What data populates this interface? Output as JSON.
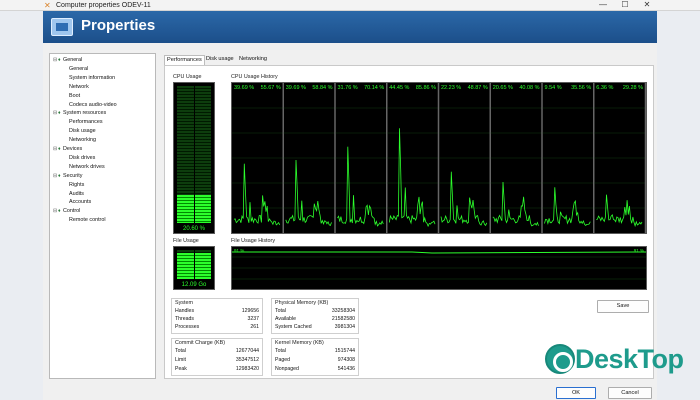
{
  "window": {
    "title": "Computer properties ODEV-11"
  },
  "header": {
    "title": "Properties"
  },
  "tree": [
    {
      "label": "General",
      "level": 0,
      "expanded": true
    },
    {
      "label": "General",
      "level": 1
    },
    {
      "label": "System information",
      "level": 1
    },
    {
      "label": "Network",
      "level": 1
    },
    {
      "label": "Boot",
      "level": 1
    },
    {
      "label": "Codecs audio-video",
      "level": 1
    },
    {
      "label": "System resources",
      "level": 0,
      "expanded": true
    },
    {
      "label": "Performances",
      "level": 1
    },
    {
      "label": "Disk usage",
      "level": 1
    },
    {
      "label": "Networking",
      "level": 1
    },
    {
      "label": "Devices",
      "level": 0,
      "expanded": true
    },
    {
      "label": "Disk drives",
      "level": 1
    },
    {
      "label": "Network drives",
      "level": 1
    },
    {
      "label": "Security",
      "level": 0,
      "expanded": true
    },
    {
      "label": "Rights",
      "level": 1
    },
    {
      "label": "Audits",
      "level": 1
    },
    {
      "label": "Accounts",
      "level": 1
    },
    {
      "label": "Control",
      "level": 0,
      "expanded": true
    },
    {
      "label": "Remote control",
      "level": 1
    }
  ],
  "tabs": [
    "Performances",
    "Disk usage",
    "Networking"
  ],
  "cpu": {
    "usage_label": "CPU Usage",
    "usage_value": "20.60 %",
    "usage_fraction": 0.206,
    "history_label": "CPU Usage History",
    "cores": [
      {
        "a": "39.69 %",
        "b": "55.67 %"
      },
      {
        "a": "39.69 %",
        "b": "58.84 %"
      },
      {
        "a": "31.76 %",
        "b": "70.14 %"
      },
      {
        "a": "44.45 %",
        "b": "85.86 %"
      },
      {
        "a": "22.23 %",
        "b": "48.87 %"
      },
      {
        "a": "20.65 %",
        "b": "40.08 %"
      },
      {
        "a": "9.54 %",
        "b": "35.56 %"
      },
      {
        "a": "6.36 %",
        "b": "29.28 %"
      }
    ]
  },
  "file": {
    "usage_label": "File Usage",
    "usage_value": "12.09 Go",
    "usage_fraction": 0.91,
    "history_label": "File Usage History",
    "left_value": "91 %",
    "right_value": "91 %"
  },
  "system": {
    "title": "System",
    "rows": [
      {
        "k": "Handles",
        "v": "129656"
      },
      {
        "k": "Threads",
        "v": "3237"
      },
      {
        "k": "Processes",
        "v": "261"
      }
    ]
  },
  "physical_memory": {
    "title": "Physical Memory (KB)",
    "rows": [
      {
        "k": "Total",
        "v": "33258304"
      },
      {
        "k": "Available",
        "v": "21582580"
      },
      {
        "k": "System Cached",
        "v": "3981304"
      }
    ]
  },
  "commit_charge": {
    "title": "Commit Charge (KB)",
    "rows": [
      {
        "k": "Total",
        "v": "12677044"
      },
      {
        "k": "Limit",
        "v": "35347512"
      },
      {
        "k": "Peak",
        "v": "12983420"
      }
    ]
  },
  "kernel_memory": {
    "title": "Kernel Memory (KB)",
    "rows": [
      {
        "k": "Total",
        "v": "1515744"
      },
      {
        "k": "Paged",
        "v": "974308"
      },
      {
        "k": "Nonpaged",
        "v": "541436"
      }
    ]
  },
  "buttons": {
    "save": "Save",
    "ok": "OK",
    "cancel": "Cancel"
  },
  "watermark": {
    "text": "DeskTop"
  },
  "colors": {
    "header": "#1f5592",
    "graph_green": "#2cff2c",
    "graph_bg": "#000000"
  }
}
